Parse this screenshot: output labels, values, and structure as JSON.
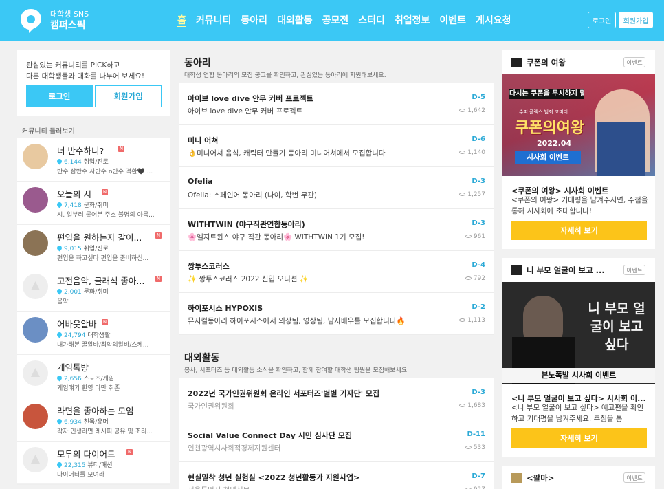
{
  "header": {
    "brand_sub": "대학생 SNS",
    "brand_name": "캠퍼스픽",
    "nav": [
      "홈",
      "커뮤니티",
      "동아리",
      "대외활동",
      "공모전",
      "스터디",
      "취업정보",
      "이벤트",
      "게시요청"
    ],
    "login": "로그인",
    "signup": "회원가입"
  },
  "sidebar": {
    "intro_line1": "관심있는 커뮤니티를 PICK하고",
    "intro_line2": "다른 대학생들과 대화를 나누어 보세요!",
    "login": "로그인",
    "signup": "회원가입",
    "browse_title": "커뮤니티 둘러보기",
    "badge": "N",
    "communities": [
      {
        "name": "너 반수하니?",
        "count": "6,144",
        "category": "취업/진로",
        "desc": "반수 삼반수 사반수 n반수 격환🖤 ...",
        "avatar": "#e8c9a0",
        "badge": true
      },
      {
        "name": "오늘의 시",
        "count": "7,418",
        "category": "문화/취미",
        "desc": "시, 일부러 뭍어본 주소 불명의 아름...",
        "avatar": "#9a5a8e",
        "badge": true
      },
      {
        "name": "편입을 원하는자 같이...",
        "count": "9,015",
        "category": "취업/진로",
        "desc": "편입을 하고싶다 편입을 준비하신...",
        "avatar": "#8b7355",
        "badge": true
      },
      {
        "name": "고전음악, 클래식 좋아...",
        "count": "2,001",
        "category": "문화/취미",
        "desc": "음악",
        "avatar": "",
        "badge": true
      },
      {
        "name": "어바웃알바",
        "count": "24,794",
        "category": "대학생활",
        "desc": "내가해본 꿀알바/최악의알바/스케...",
        "avatar": "#6b8fc4",
        "badge": true
      },
      {
        "name": "게임톡방",
        "count": "2,656",
        "category": "스포츠/게임",
        "desc": "게임얘기 환영 다만 취존",
        "avatar": "",
        "badge": false
      },
      {
        "name": "라면을 좋아하는 모임",
        "count": "6,934",
        "category": "친목/유머",
        "desc": "각자 인생라면 레시피 공유 및 조리...",
        "avatar": "#c8553d",
        "badge": false
      },
      {
        "name": "모두의 다이어트",
        "count": "22,315",
        "category": "뷰티/패션",
        "desc": "다이어터를 모여라",
        "avatar": "",
        "badge": true
      }
    ]
  },
  "clubs": {
    "title": "동아리",
    "desc": "대학생 연합 동아리의 모집 공고를 확인하고, 관심있는 동아리에 지원해보세요.",
    "posts": [
      {
        "title": "아이브 love dive 안무 커버 프로젝트",
        "sub": "아이브 love dive 안무 커버 프로젝트",
        "dday": "D-5",
        "views": "1,642"
      },
      {
        "title": "미니 어쳐",
        "sub": "👌미니어쳐 음식, 캐릭터 만들기 동아리 미니어쳐에서 모집합니다",
        "dday": "D-6",
        "views": "1,140"
      },
      {
        "title": "Ofelia",
        "sub": "Ofelia: 스페인어 동아리 (나이, 학번 무관)",
        "dday": "D-3",
        "views": "1,257"
      },
      {
        "title": "WITHTWIN (야구직관연합동아리)",
        "sub": "🌸엘지트윈스 야구 직관 동아리🌸 WITHTWIN 1기 모집!",
        "dday": "D-3",
        "views": "961"
      },
      {
        "title": "쌍투스코러스",
        "sub": "✨ 쌍투스코러스 2022 신입 오디션 ✨",
        "dday": "D-4",
        "views": "792"
      },
      {
        "title": "하이포시스 HYPOXIS",
        "sub": "뮤지컬동아리 하이포시스에서 의상팀, 영상팀, 남자배우를 모집합니다🔥",
        "dday": "D-2",
        "views": "1,113"
      }
    ]
  },
  "activities": {
    "title": "대외활동",
    "desc": "봉사, 서포터즈 등 대외활동 소식을 확인하고, 함께 참여할 대학생 팀원을 모집해보세요.",
    "posts": [
      {
        "title": "2022년 국가인권위원회 온라인 서포터즈'별별 기자단' 모집",
        "sub": "국가인권위원회",
        "dday": "D-3",
        "views": "1,683"
      },
      {
        "title": "Social Value Connect Day 시민 심사단 모집",
        "sub": "인천광역시사회적경제지원센터",
        "dday": "D-11",
        "views": "533"
      },
      {
        "title": "현실밀착 청년 실험실 <2022 청년활동가 지원사업>",
        "sub": "서울특별시 청년허브",
        "dday": "D-7",
        "views": "927"
      }
    ]
  },
  "events": {
    "tag": "이벤트",
    "button": "자세히 보기",
    "cards": [
      {
        "head": "쿠폰의 여왕",
        "title": "<쿠폰의 여왕> 시사회 이벤트",
        "desc": "<쿠폰의 여왕> 기대평을 남겨주시면, 주첨을 통해 시사회에 초대합니다!",
        "poster_top": "다시는 쿠폰을 무시하지 말라!",
        "poster_mid": "쿠폰의여왕",
        "poster_date": "2022.04",
        "poster_tag": "시사회 이벤트",
        "poster_small": "수퍼 플렉스 범죄 코미디"
      },
      {
        "head": "니 부모 얼굴이 보고 ...",
        "title": "<니 부모 얼굴이 보고 싶다> 시사회 이...",
        "desc": "<니 부모 얼굴이 보고 싶다> 예고편을 확인하고 기대평을 남겨주세요. 추첨을 통",
        "poster_mid": "니 부모 얼굴이 보고싶다",
        "poster_tag": "븐노폭발 시사회 이벤트"
      },
      {
        "head": "<팔마>"
      }
    ]
  }
}
